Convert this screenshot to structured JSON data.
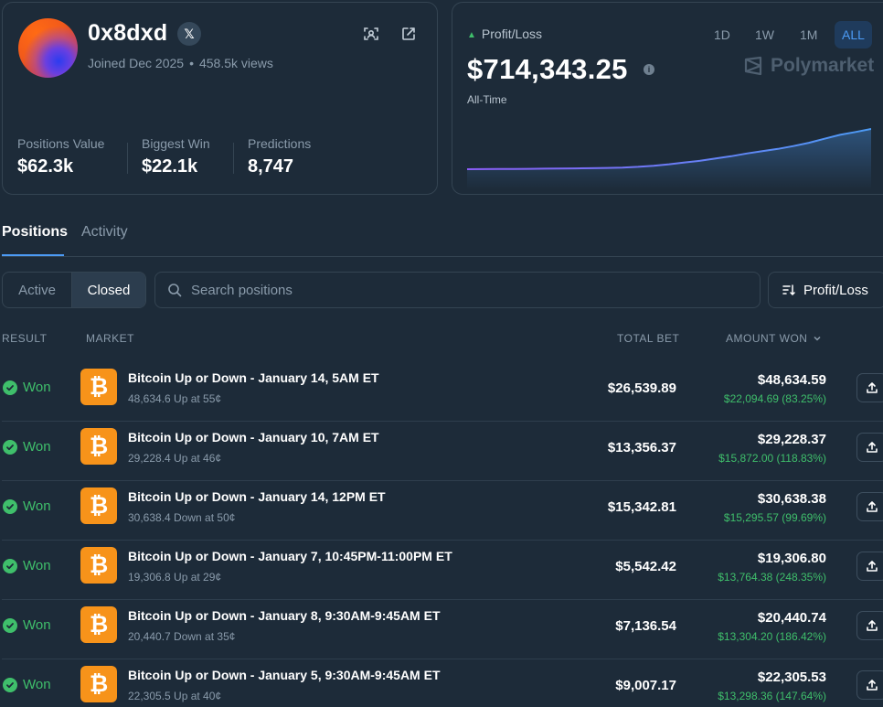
{
  "profile": {
    "username": "0x8dxd",
    "x_badge": "𝕏",
    "joined": "Joined Dec 2025",
    "views": "458.5k views",
    "stats": [
      {
        "label": "Positions Value",
        "value": "$62.3k"
      },
      {
        "label": "Biggest Win",
        "value": "$22.1k"
      },
      {
        "label": "Predictions",
        "value": "8,747"
      }
    ]
  },
  "pnl": {
    "label": "Profit/Loss",
    "value": "$714,343.25",
    "info_glyph": "i",
    "sub": "All-Time",
    "timeframes": [
      "1D",
      "1W",
      "1M",
      "ALL"
    ],
    "active_timeframe": "ALL",
    "brand": "Polymarket",
    "accent": "#4c9bf5",
    "positive_color": "#3fbf6b"
  },
  "chart_data": {
    "type": "area",
    "title": "",
    "xlabel": "",
    "ylabel": "",
    "series": [
      {
        "values": [
          0,
          1400,
          2600,
          4000,
          6500,
          9000,
          11500,
          14000,
          17500,
          22000,
          30000,
          42000,
          62000,
          88000,
          120000,
          150000,
          190000,
          230000,
          280000,
          320000,
          360000,
          410000,
          470000,
          540000,
          610000,
          660000,
          714343
        ]
      }
    ],
    "color_start": "#8b5cf6",
    "color_end": "#4c9bf5",
    "grid": false
  },
  "tabs": [
    "Positions",
    "Activity"
  ],
  "active_tab": "Positions",
  "filter": {
    "segments": [
      "Active",
      "Closed"
    ],
    "selected": "Closed"
  },
  "search": {
    "placeholder": "Search positions"
  },
  "sort": {
    "label": "Profit/Loss"
  },
  "table": {
    "headers": {
      "result": "RESULT",
      "market": "MARKET",
      "total_bet": "TOTAL BET",
      "amount_won": "AMOUNT WON"
    },
    "rows": [
      {
        "result": "Won",
        "title": "Bitcoin Up or Down - January 14, 5AM ET",
        "sub": "48,634.6 Up at 55¢",
        "bet": "$26,539.89",
        "won": "$48,634.59",
        "gain": "$22,094.69 (83.25%)"
      },
      {
        "result": "Won",
        "title": "Bitcoin Up or Down - January 10, 7AM ET",
        "sub": "29,228.4 Up at 46¢",
        "bet": "$13,356.37",
        "won": "$29,228.37",
        "gain": "$15,872.00 (118.83%)"
      },
      {
        "result": "Won",
        "title": "Bitcoin Up or Down - January 14, 12PM ET",
        "sub": "30,638.4 Down at 50¢",
        "bet": "$15,342.81",
        "won": "$30,638.38",
        "gain": "$15,295.57 (99.69%)"
      },
      {
        "result": "Won",
        "title": "Bitcoin Up or Down - January 7, 10:45PM-11:00PM ET",
        "sub": "19,306.8 Up at 29¢",
        "bet": "$5,542.42",
        "won": "$19,306.80",
        "gain": "$13,764.38 (248.35%)"
      },
      {
        "result": "Won",
        "title": "Bitcoin Up or Down - January 8, 9:30AM-9:45AM ET",
        "sub": "20,440.7 Down at 35¢",
        "bet": "$7,136.54",
        "won": "$20,440.74",
        "gain": "$13,304.20 (186.42%)"
      },
      {
        "result": "Won",
        "title": "Bitcoin Up or Down - January 5, 9:30AM-9:45AM ET",
        "sub": "22,305.5 Up at 40¢",
        "bet": "$9,007.17",
        "won": "$22,305.53",
        "gain": "$13,298.36 (147.64%)"
      }
    ]
  }
}
